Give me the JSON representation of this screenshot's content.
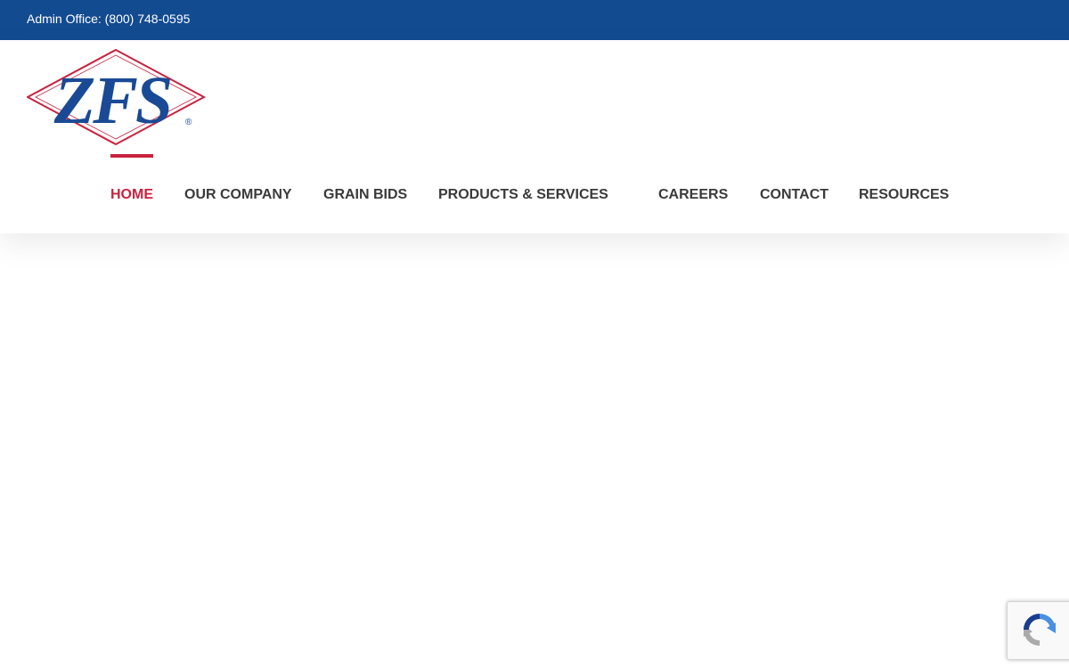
{
  "topbar": {
    "text": "Admin Office: (800) 748-0595"
  },
  "logo": {
    "text": "ZFS",
    "registered": "®",
    "colors": {
      "text": "#1a4a95",
      "diamond": "#c8233f"
    }
  },
  "nav": {
    "items": [
      {
        "label": "HOME",
        "active": true
      },
      {
        "label": "OUR COMPANY",
        "active": false
      },
      {
        "label": "GRAIN BIDS",
        "active": false
      },
      {
        "label": "PRODUCTS & SERVICES",
        "active": false
      },
      {
        "label": "CAREERS",
        "active": false
      },
      {
        "label": "CONTACT",
        "active": false
      },
      {
        "label": "RESOURCES",
        "active": false
      }
    ]
  },
  "colors": {
    "topbar": "#134b91",
    "accent": "#c8233f",
    "nav_text": "#3a3a3a"
  },
  "recaptcha": {
    "icon": "recaptcha-icon"
  }
}
